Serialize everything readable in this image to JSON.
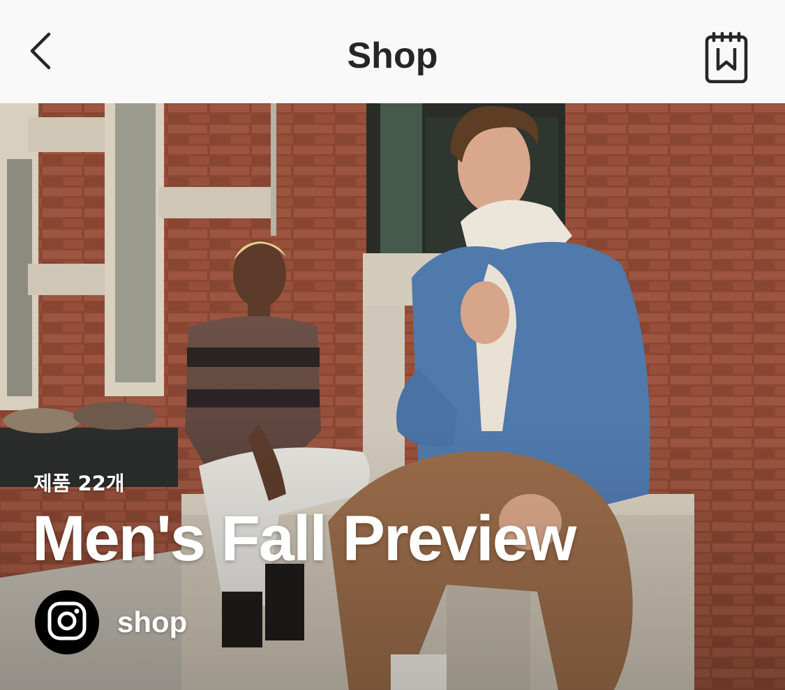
{
  "header": {
    "title": "Shop",
    "back_icon": "chevron-left-icon",
    "saved_icon": "bookmark-calendar-icon"
  },
  "collection": {
    "product_count": "제품 22개",
    "title": "Men's Fall Preview",
    "seller_name": "shop",
    "seller_icon": "instagram-icon"
  },
  "colors": {
    "header_bg": "#f9f9f9",
    "title_text": "#262626",
    "brick": "#8e4a33",
    "denim": "#4f77a8"
  }
}
